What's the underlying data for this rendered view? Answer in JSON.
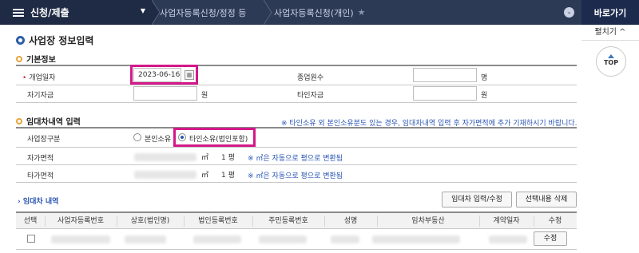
{
  "nav": {
    "menu_label": "신청/제출",
    "breadcrumb_1": "사업자등록신청/정정 등",
    "breadcrumb_2": "사업자등록신청(개인)",
    "star": "★",
    "dropdown": "⌄"
  },
  "rail": {
    "shortcut": "바로가기",
    "expand": "펼치기 ^",
    "top": "TOP"
  },
  "page_title": "사업장 정보입력",
  "basic": {
    "title": "기본정보",
    "open_date_label": "개업일자",
    "open_date_value": "2023-06-16",
    "calendar_icon": "▦",
    "employees_label": "종업원수",
    "employees_unit": "명",
    "own_capital_label": "자기자금",
    "own_capital_unit": "원",
    "other_capital_label": "타인자금",
    "other_capital_unit": "원"
  },
  "lease_input": {
    "title": "임대차내역 입력",
    "note": "※ 타인소유 외 본인소유분도 있는 경우, 임대차내역 입력 후 자가면적에 추가 기재하시기 바랍니다.",
    "site_type_label": "사업장구분",
    "option_self": "본인소유",
    "option_other": "타인소유(법인포함)",
    "own_area_label": "자가면적",
    "other_area_label": "타가면적",
    "area_unit": "㎡",
    "pyeong_text": "1 평",
    "convert_note": "※ ㎡은 자동으로 평으로 변환됨"
  },
  "lease_table": {
    "title": "임대차 내역",
    "btn_input": "임대차 입력/수정",
    "btn_delete": "선택내용 삭제",
    "columns": [
      "선택",
      "사업자등록번호",
      "상호(법인명)",
      "법인등록번호",
      "주민등록번호",
      "성명",
      "임차부동산",
      "계약일자",
      "수정"
    ],
    "row_edit": "수정"
  }
}
